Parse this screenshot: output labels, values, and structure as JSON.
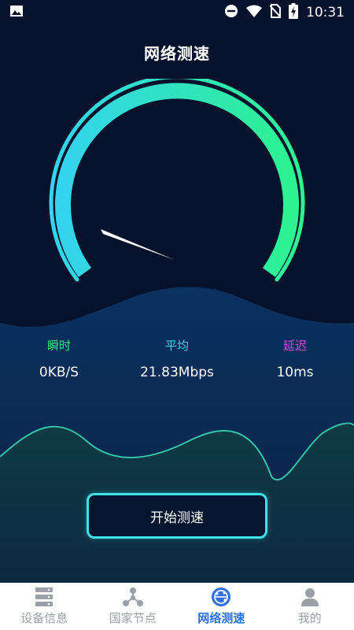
{
  "status_bar": {
    "time": "10:31"
  },
  "header": {
    "title": "网络测速"
  },
  "gauge": {
    "needle_fraction": 0.1
  },
  "stats": [
    {
      "label": "瞬时",
      "value": "0KB/S",
      "color": "#38e38f"
    },
    {
      "label": "平均",
      "value": "21.83Mbps",
      "color": "#3ad7e8"
    },
    {
      "label": "延迟",
      "value": "10ms",
      "color": "#c94cf0"
    }
  ],
  "start_button": {
    "label": "开始测速"
  },
  "tabbar": {
    "items": [
      {
        "label": "设备信息",
        "icon": "device-info-icon",
        "active": false
      },
      {
        "label": "国家节点",
        "icon": "nodes-icon",
        "active": false
      },
      {
        "label": "网络测速",
        "icon": "speedtest-icon",
        "active": true
      },
      {
        "label": "我的",
        "icon": "user-icon",
        "active": false
      }
    ]
  },
  "colors": {
    "accent": "#3ee3e9",
    "active_tab": "#2f6fe3",
    "background": "#06122b"
  }
}
